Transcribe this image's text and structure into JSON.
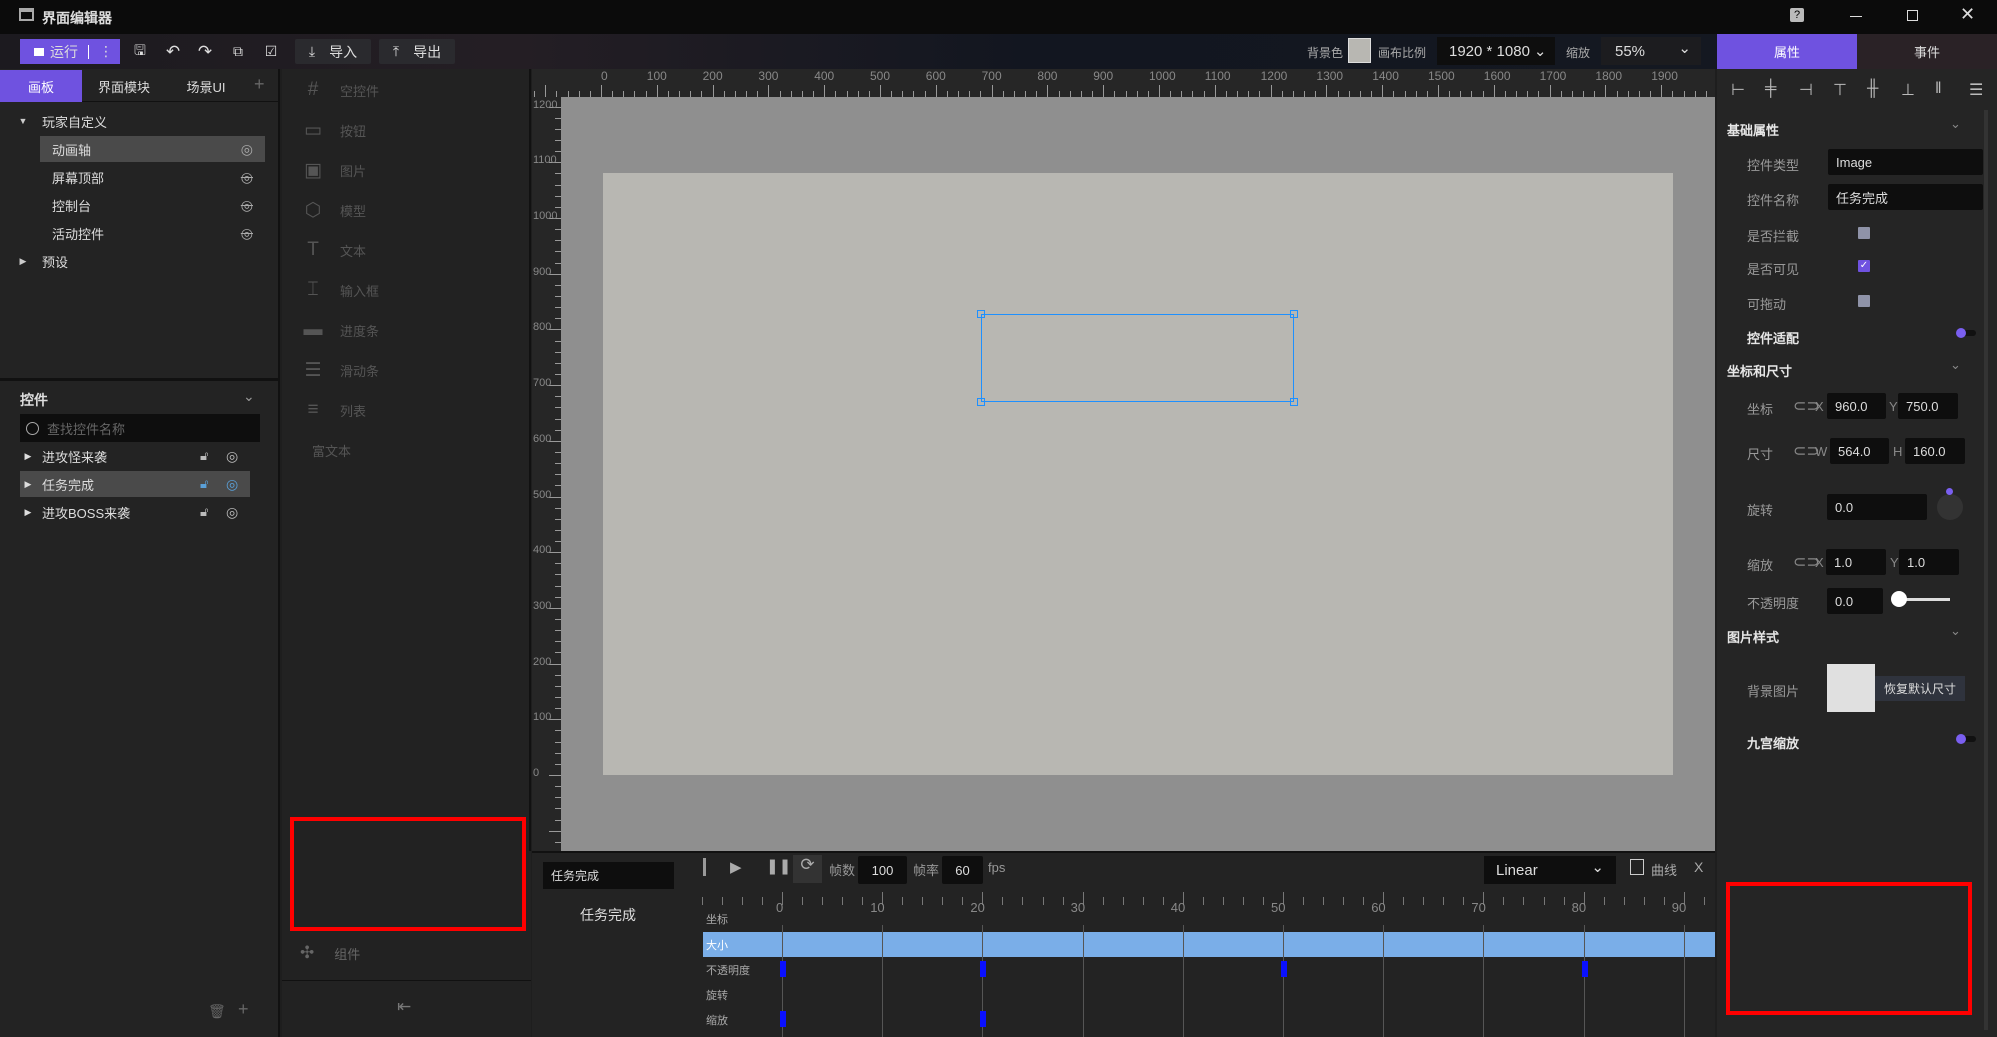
{
  "app": {
    "title": "界面编辑器"
  },
  "toolbar": {
    "run": "运行",
    "import": "导入",
    "export": "导出",
    "bg_color_label": "背景色",
    "bg_color": "#b8b7b2",
    "ratio_label": "画布比例",
    "ratio_value": "1920 * 1080",
    "zoom_label": "缩放",
    "zoom_value": "55%"
  },
  "left": {
    "tabs": [
      "画板",
      "界面模块",
      "场景UI"
    ],
    "tree": [
      {
        "label": "玩家自定义",
        "level": 0,
        "expanded": true
      },
      {
        "label": "动画轴",
        "level": 1,
        "visible": true,
        "selected": true
      },
      {
        "label": "屏幕顶部",
        "level": 1,
        "visible": false
      },
      {
        "label": "控制台",
        "level": 1,
        "visible": false
      },
      {
        "label": "活动控件",
        "level": 1,
        "visible": false
      },
      {
        "label": "预设",
        "level": 0,
        "expanded": false
      }
    ],
    "controls_title": "控件",
    "search_placeholder": "查找控件名称",
    "controls": [
      {
        "label": "进攻怪来袭",
        "selected": false
      },
      {
        "label": "任务完成",
        "selected": true
      },
      {
        "label": "进攻BOSS来袭",
        "selected": false
      }
    ]
  },
  "widgets": {
    "items": [
      {
        "icon": "grid-icon",
        "glyph": "#",
        "label": "空控件"
      },
      {
        "icon": "button-icon",
        "glyph": "▭",
        "label": "按钮"
      },
      {
        "icon": "image-icon",
        "glyph": "▣",
        "label": "图片"
      },
      {
        "icon": "cube-icon",
        "glyph": "⬡",
        "label": "模型"
      },
      {
        "icon": "text-icon",
        "glyph": "T",
        "label": "文本"
      },
      {
        "icon": "input-icon",
        "glyph": "⌶",
        "label": "输入框"
      },
      {
        "icon": "progress-icon",
        "glyph": "▬",
        "label": "进度条"
      },
      {
        "icon": "slider-icon",
        "glyph": "☰",
        "label": "滑动条"
      },
      {
        "icon": "list-icon",
        "glyph": "≡",
        "label": "列表"
      },
      {
        "icon": "",
        "glyph": "",
        "label": "富文本"
      }
    ],
    "component_label": "组件"
  },
  "canvas": {
    "ruler_x": [
      "0",
      "100",
      "200",
      "300",
      "400",
      "500",
      "600",
      "700",
      "800",
      "900",
      "1000",
      "1100",
      "1200",
      "1300",
      "1400",
      "1500",
      "1600",
      "1700",
      "1800",
      "1900"
    ],
    "ruler_y": [
      "0",
      "100",
      "200",
      "300",
      "400",
      "500",
      "600",
      "700",
      "800",
      "900",
      "1000",
      "1100",
      "1200"
    ]
  },
  "timeline": {
    "selected_name": "任务完成",
    "track_name": "任务完成",
    "frames_label": "帧数",
    "frames": "100",
    "fps_label": "帧率",
    "fps": "60",
    "fps_unit": "fps",
    "easing": "Linear",
    "curve_label": "曲线",
    "close": "X",
    "ticks": [
      "0",
      "10",
      "20",
      "30",
      "40",
      "50",
      "60",
      "70",
      "80",
      "90"
    ],
    "rows": [
      {
        "label": "坐标",
        "keys": []
      },
      {
        "label": "大小",
        "keys": [],
        "selected": true
      },
      {
        "label": "不透明度",
        "keys": [
          0,
          20,
          50,
          80
        ]
      },
      {
        "label": "旋转",
        "keys": []
      },
      {
        "label": "缩放",
        "keys": [
          0,
          20
        ]
      }
    ]
  },
  "right": {
    "tabs": [
      "属性",
      "事件"
    ],
    "basic": "基础属性",
    "type_label": "控件类型",
    "type_value": "Image",
    "name_label": "控件名称",
    "name_value": "任务完成",
    "intercept_label": "是否拦截",
    "intercept": false,
    "visible_label": "是否可见",
    "visible": true,
    "drag_label": "可拖动",
    "drag": false,
    "adapt_label": "控件适配",
    "pos_head": "坐标和尺寸",
    "pos_label": "坐标",
    "x_label": "X",
    "x": "960.0",
    "y_label": "Y",
    "y": "750.0",
    "size_label": "尺寸",
    "w_label": "W",
    "w": "564.0",
    "h_label": "H",
    "h": "160.0",
    "rot_label": "旋转",
    "rot": "0.0",
    "scale_label": "缩放",
    "sx_label": "X",
    "sx": "1.0",
    "sy_label": "Y",
    "sy": "1.0",
    "opacity_label": "不透明度",
    "opacity": "0.0",
    "img_head": "图片样式",
    "bgimg_label": "背景图片",
    "reset_size": "恢复默认尺寸",
    "nine_label": "九宫缩放"
  },
  "colors": {
    "accent": "#6f52e0",
    "selection": "#1e90ff",
    "keyframe": "#0a10ff",
    "track_selected": "#7aaee8",
    "highlight_box": "#ff0000"
  }
}
